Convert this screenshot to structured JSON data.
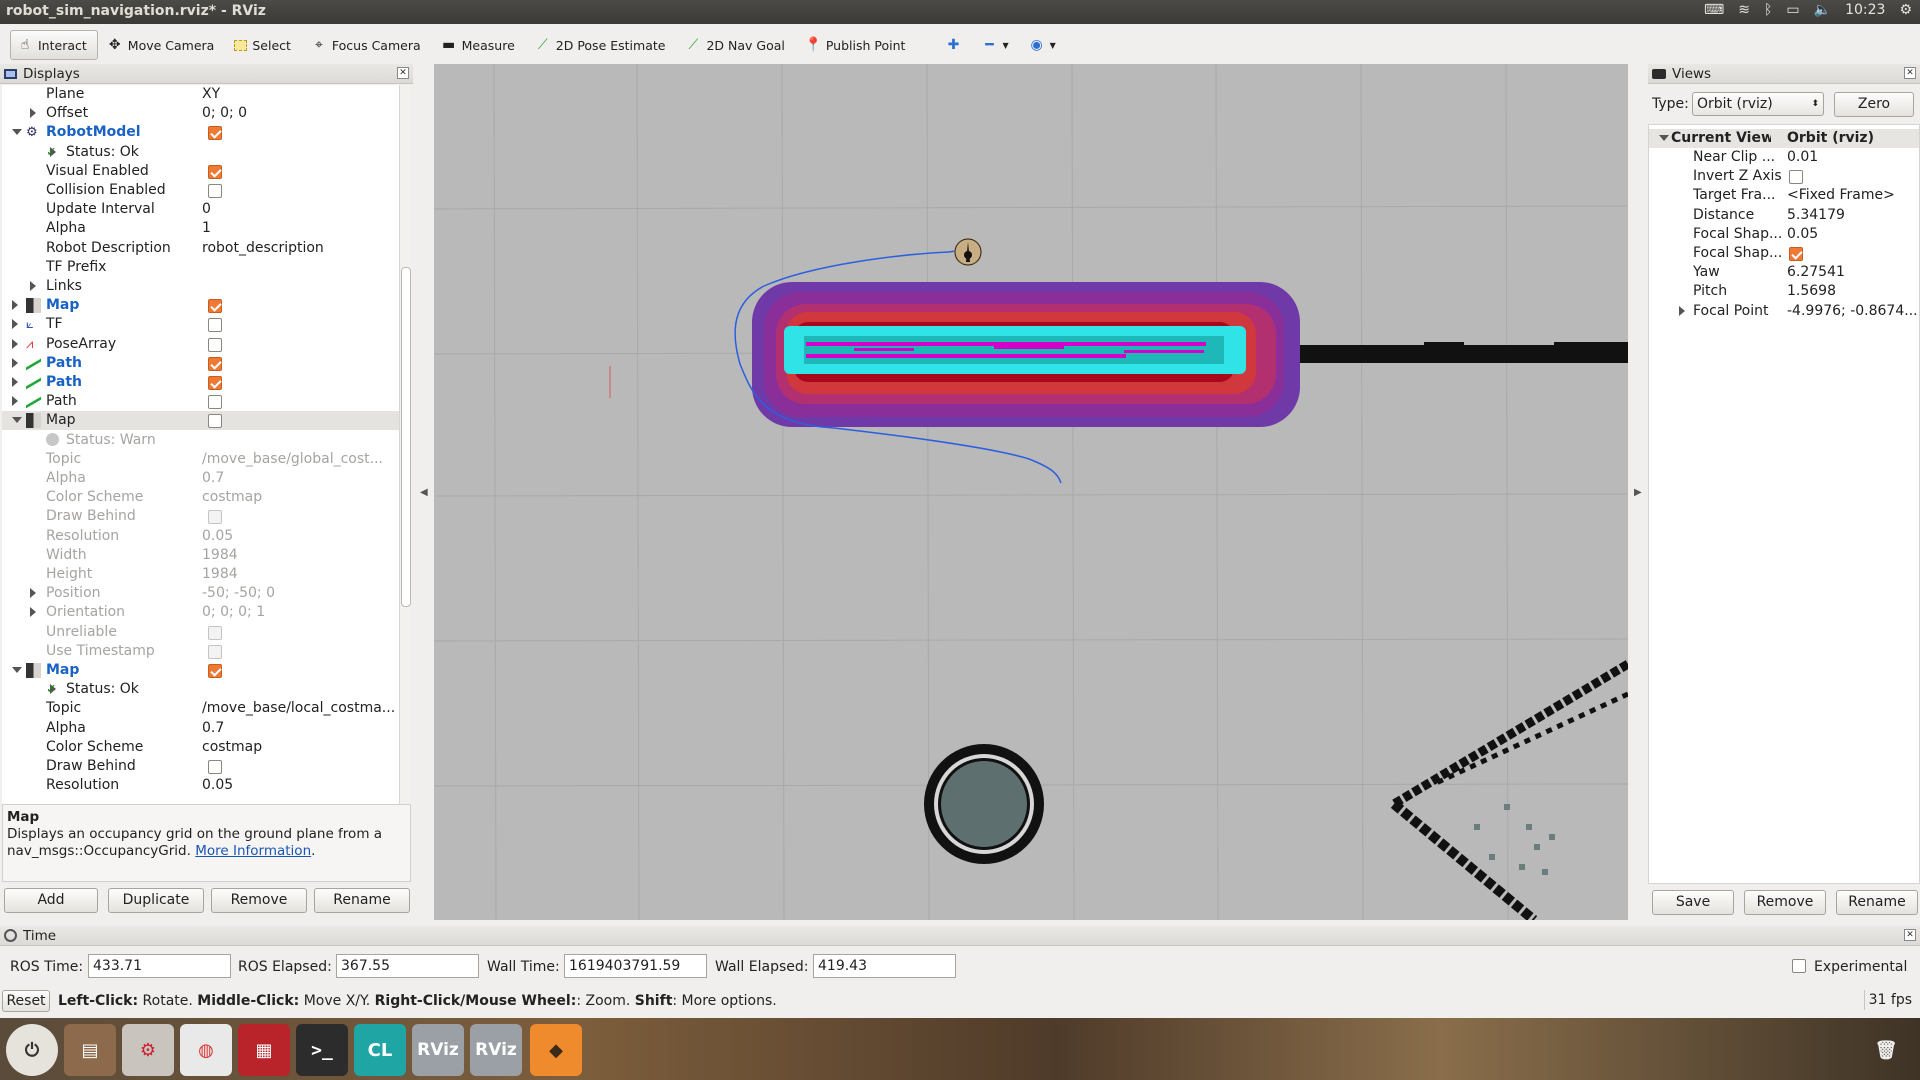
{
  "window": {
    "title": "robot_sim_navigation.rviz* - RViz"
  },
  "tray": {
    "time": "10:23"
  },
  "toolbar": {
    "tools": [
      {
        "label": "Interact",
        "icon": "hand-icon"
      },
      {
        "label": "Move Camera",
        "icon": "move-camera-icon"
      },
      {
        "label": "Select",
        "icon": "select-icon"
      },
      {
        "label": "Focus Camera",
        "icon": "focus-camera-icon"
      },
      {
        "label": "Measure",
        "icon": "ruler-icon"
      },
      {
        "label": "2D Pose Estimate",
        "icon": "green-arrow-icon"
      },
      {
        "label": "2D Nav Goal",
        "icon": "green-arrow-icon"
      },
      {
        "label": "Publish Point",
        "icon": "map-pin-icon"
      }
    ]
  },
  "displays": {
    "title": "Displays",
    "rows": [
      {
        "name": "Plane",
        "value": "XY"
      },
      {
        "name": "Offset",
        "value": "0; 0; 0"
      },
      {
        "name": "RobotModel",
        "value": ""
      },
      {
        "name": "Status: Ok",
        "value": ""
      },
      {
        "name": "Visual Enabled",
        "value": ""
      },
      {
        "name": "Collision Enabled",
        "value": ""
      },
      {
        "name": "Update Interval",
        "value": "0"
      },
      {
        "name": "Alpha",
        "value": "1"
      },
      {
        "name": "Robot Description",
        "value": "robot_description"
      },
      {
        "name": "TF Prefix",
        "value": ""
      },
      {
        "name": "Links",
        "value": ""
      },
      {
        "name": "Map",
        "value": ""
      },
      {
        "name": "TF",
        "value": ""
      },
      {
        "name": "PoseArray",
        "value": ""
      },
      {
        "name": "Path",
        "value": ""
      },
      {
        "name": "Path",
        "value": ""
      },
      {
        "name": "Path",
        "value": ""
      },
      {
        "name": "Map",
        "value": ""
      },
      {
        "name": "Status: Warn",
        "value": ""
      },
      {
        "name": "Topic",
        "value": "/move_base/global_cost..."
      },
      {
        "name": "Alpha",
        "value": "0.7"
      },
      {
        "name": "Color Scheme",
        "value": "costmap"
      },
      {
        "name": "Draw Behind",
        "value": ""
      },
      {
        "name": "Resolution",
        "value": "0.05"
      },
      {
        "name": "Width",
        "value": "1984"
      },
      {
        "name": "Height",
        "value": "1984"
      },
      {
        "name": "Position",
        "value": "-50; -50; 0"
      },
      {
        "name": "Orientation",
        "value": "0; 0; 0; 1"
      },
      {
        "name": "Unreliable",
        "value": ""
      },
      {
        "name": "Use Timestamp",
        "value": ""
      },
      {
        "name": "Map",
        "value": ""
      },
      {
        "name": "Status: Ok",
        "value": ""
      },
      {
        "name": "Topic",
        "value": "/move_base/local_costma..."
      },
      {
        "name": "Alpha",
        "value": "0.7"
      },
      {
        "name": "Color Scheme",
        "value": "costmap"
      },
      {
        "name": "Draw Behind",
        "value": ""
      },
      {
        "name": "Resolution",
        "value": "0.05"
      }
    ],
    "description": {
      "title": "Map",
      "text": "Displays an occupancy grid on the ground plane from a nav_msgs::OccupancyGrid.",
      "link": "More Information"
    },
    "buttons": {
      "add": "Add",
      "duplicate": "Duplicate",
      "remove": "Remove",
      "rename": "Rename"
    }
  },
  "views": {
    "title": "Views",
    "type_label": "Type:",
    "type_value": "Orbit (rviz)",
    "zero": "Zero",
    "current_view": {
      "label": "Current View",
      "value": "Orbit (rviz)"
    },
    "rows": [
      {
        "key": "Near Clip ...",
        "value": "0.01"
      },
      {
        "key": "Invert Z Axis",
        "value": ""
      },
      {
        "key": "Target Fra...",
        "value": "<Fixed Frame>"
      },
      {
        "key": "Distance",
        "value": "5.34179"
      },
      {
        "key": "Focal Shap...",
        "value": "0.05"
      },
      {
        "key": "Focal Shap...",
        "value": ""
      },
      {
        "key": "Yaw",
        "value": "6.27541"
      },
      {
        "key": "Pitch",
        "value": "1.5698"
      },
      {
        "key": "Focal Point",
        "value": "-4.9976; -0.8674..."
      }
    ],
    "buttons": {
      "save": "Save",
      "remove": "Remove",
      "rename": "Rename"
    }
  },
  "time": {
    "title": "Time",
    "ros_time_label": "ROS Time:",
    "ros_time": "433.71",
    "ros_elapsed_label": "ROS Elapsed:",
    "ros_elapsed": "367.55",
    "wall_time_label": "Wall Time:",
    "wall_time": "1619403791.59",
    "wall_elapsed_label": "Wall Elapsed:",
    "wall_elapsed": "419.43",
    "experimental": "Experimental"
  },
  "status": {
    "reset": "Reset",
    "left_click": "Left-Click:",
    "left_click_text": " Rotate. ",
    "middle_click": "Middle-Click:",
    "middle_click_text": " Move X/Y. ",
    "right_click": "Right-Click/Mouse Wheel:",
    "right_click_text": ": Zoom. ",
    "shift": "Shift",
    "shift_text": ": More options.",
    "fps": "31 fps"
  },
  "taskbar": {
    "clion": "CL",
    "rviz1": "RViz",
    "rviz2": "RViz"
  }
}
